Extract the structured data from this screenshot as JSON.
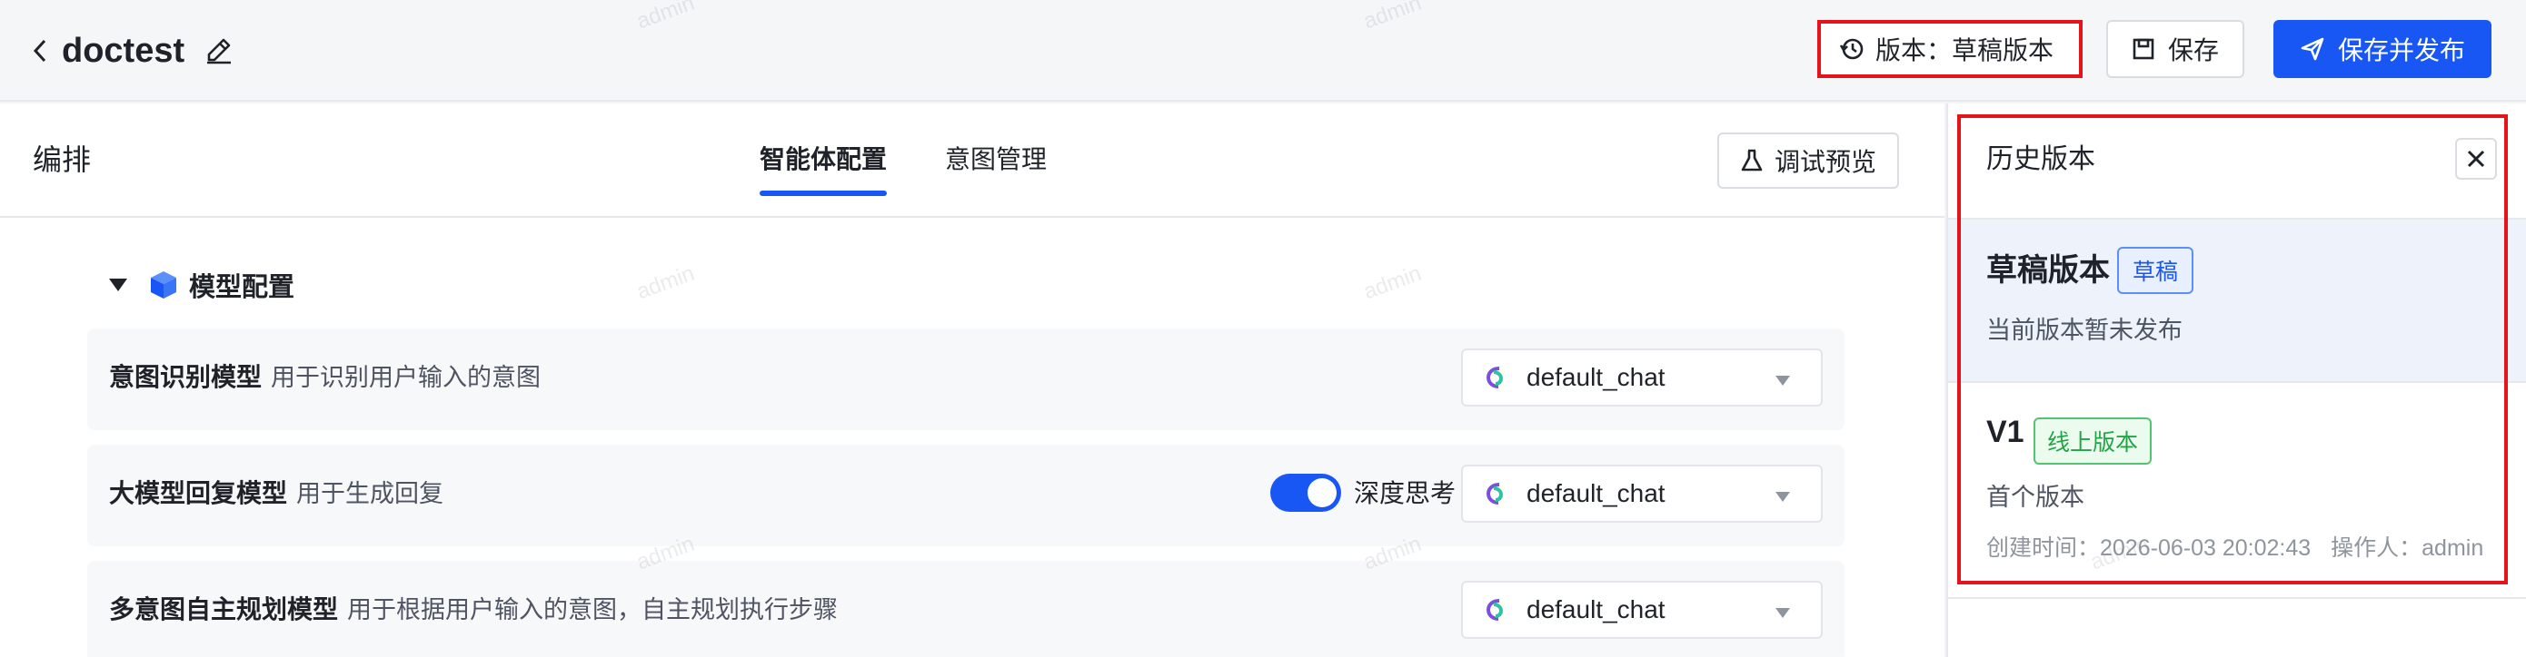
{
  "header": {
    "title": "doctest",
    "version_label": "版本：草稿版本",
    "save_label": "保存",
    "publish_label": "保存并发布"
  },
  "main": {
    "title": "编排",
    "tabs": [
      {
        "label": "智能体配置",
        "active": true
      },
      {
        "label": "意图管理",
        "active": false
      }
    ],
    "debug_label": "调试预览",
    "section_title": "模型配置",
    "rows": [
      {
        "name": "意图识别模型",
        "desc": "用于识别用户输入的意图",
        "model": "default_chat"
      },
      {
        "name": "大模型回复模型",
        "desc": "用于生成回复",
        "model": "default_chat",
        "toggle_label": "深度思考",
        "toggle_on": true
      },
      {
        "name": "多意图自主规划模型",
        "desc": "用于根据用户输入的意图，自主规划执行步骤",
        "model": "default_chat"
      }
    ]
  },
  "history": {
    "title": "历史版本",
    "items": [
      {
        "name": "草稿版本",
        "tag": "草稿",
        "desc": "当前版本暂未发布"
      },
      {
        "name": "V1",
        "tag": "线上版本",
        "desc": "首个版本",
        "created": "创建时间：2026-06-03 20:02:43",
        "operator": "操作人：admin"
      }
    ]
  },
  "watermark": "admin",
  "colors": {
    "primary": "#1957f5",
    "highlight": "#e5131a",
    "online": "#22a447"
  }
}
